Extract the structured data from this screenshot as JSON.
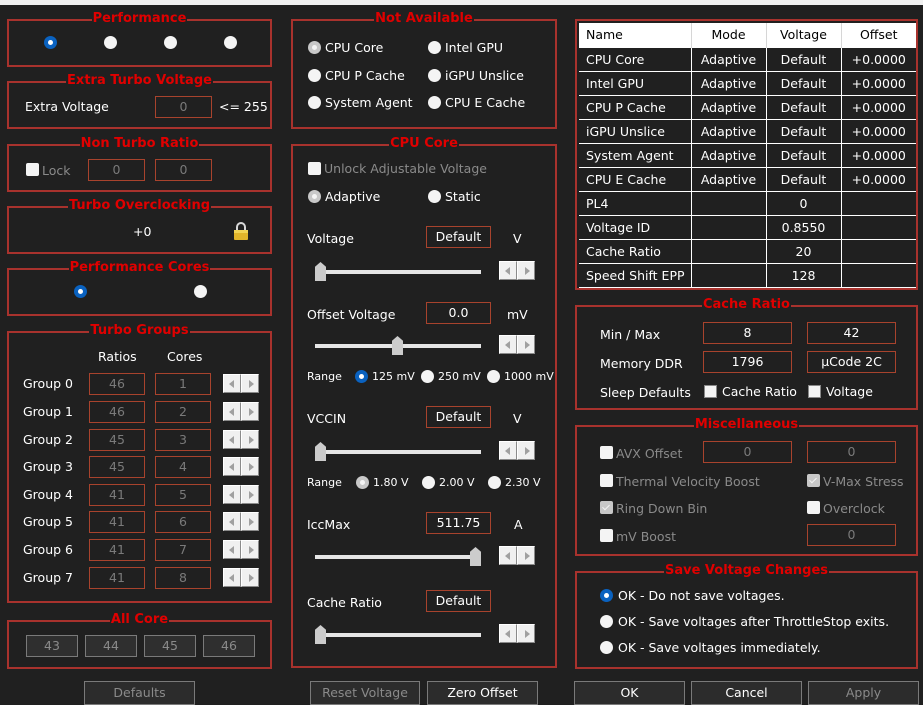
{
  "performance": {
    "title": "Performance",
    "options": [
      {
        "selected": true
      },
      {
        "selected": false
      },
      {
        "selected": false
      },
      {
        "selected": false
      }
    ]
  },
  "extra_turbo_voltage": {
    "title": "Extra Turbo Voltage",
    "label": "Extra Voltage",
    "value": "0",
    "limit": "<= 255"
  },
  "non_turbo_ratio": {
    "title": "Non Turbo Ratio",
    "lock_label": "Lock",
    "lock_checked": false,
    "value1": "0",
    "value2": "0"
  },
  "turbo_overclocking": {
    "title": "Turbo Overclocking",
    "value": "+0",
    "icon": "lock-icon"
  },
  "performance_cores": {
    "title": "Performance Cores",
    "options": [
      {
        "selected": true
      },
      {
        "selected": false
      }
    ]
  },
  "turbo_groups": {
    "title": "Turbo Groups",
    "col_ratios": "Ratios",
    "col_cores": "Cores",
    "groups": [
      {
        "label": "Group 0",
        "ratio": "46",
        "cores": "1"
      },
      {
        "label": "Group 1",
        "ratio": "46",
        "cores": "2"
      },
      {
        "label": "Group 2",
        "ratio": "45",
        "cores": "3"
      },
      {
        "label": "Group 3",
        "ratio": "45",
        "cores": "4"
      },
      {
        "label": "Group 4",
        "ratio": "41",
        "cores": "5"
      },
      {
        "label": "Group 5",
        "ratio": "41",
        "cores": "6"
      },
      {
        "label": "Group 6",
        "ratio": "41",
        "cores": "7"
      },
      {
        "label": "Group 7",
        "ratio": "41",
        "cores": "8"
      }
    ]
  },
  "all_core": {
    "title": "All Core",
    "values": [
      "43",
      "44",
      "45",
      "46"
    ]
  },
  "defaults_button": "Defaults",
  "not_available": {
    "title": "Not Available",
    "options": [
      {
        "label": "CPU Core",
        "selected": true
      },
      {
        "label": "Intel GPU",
        "selected": false
      },
      {
        "label": "CPU P Cache",
        "selected": false
      },
      {
        "label": "iGPU Unslice",
        "selected": false
      },
      {
        "label": "System Agent",
        "selected": false
      },
      {
        "label": "CPU E Cache",
        "selected": false
      }
    ]
  },
  "cpu_core": {
    "title": "CPU Core",
    "unlock_label": "Unlock Adjustable Voltage",
    "unlock_checked": false,
    "mode_adaptive": "Adaptive",
    "mode_static": "Static",
    "mode_selected": "Adaptive",
    "voltage": {
      "label": "Voltage",
      "value": "Default",
      "unit": "V",
      "slider": 0.0
    },
    "offset_voltage": {
      "label": "Offset Voltage",
      "value": "0.0",
      "unit": "mV",
      "slider": 0.5
    },
    "offset_range": {
      "label": "Range",
      "options": [
        "125 mV",
        "250 mV",
        "1000 mV"
      ],
      "selected": "125 mV"
    },
    "vccin": {
      "label": "VCCIN",
      "value": "Default",
      "unit": "V",
      "slider": 0.0
    },
    "vccin_range": {
      "label": "Range",
      "options": [
        "1.80 V",
        "2.00 V",
        "2.30 V"
      ],
      "selected": "1.80 V"
    },
    "iccmax": {
      "label": "IccMax",
      "value": "511.75",
      "unit": "A",
      "slider": 1.0
    },
    "cache_ratio": {
      "label": "Cache Ratio",
      "value": "Default",
      "slider": 0.0
    }
  },
  "reset_voltage_button": "Reset Voltage",
  "zero_offset_button": "Zero Offset",
  "table": {
    "headers": [
      "Name",
      "Mode",
      "Voltage",
      "Offset"
    ],
    "rows": [
      [
        "CPU Core",
        "Adaptive",
        "Default",
        "+0.0000"
      ],
      [
        "Intel GPU",
        "Adaptive",
        "Default",
        "+0.0000"
      ],
      [
        "CPU P Cache",
        "Adaptive",
        "Default",
        "+0.0000"
      ],
      [
        "iGPU Unslice",
        "Adaptive",
        "Default",
        "+0.0000"
      ],
      [
        "System Agent",
        "Adaptive",
        "Default",
        "+0.0000"
      ],
      [
        "CPU E Cache",
        "Adaptive",
        "Default",
        "+0.0000"
      ],
      [
        "PL4",
        "",
        "0",
        ""
      ],
      [
        "Voltage ID",
        "",
        "0.8550",
        ""
      ],
      [
        "Cache Ratio",
        "",
        "20",
        ""
      ],
      [
        "Speed Shift EPP",
        "",
        "128",
        ""
      ]
    ]
  },
  "cache_ratio_group": {
    "title": "Cache Ratio",
    "minmax_label": "Min / Max",
    "min": "8",
    "max": "42",
    "memory_label": "Memory DDR",
    "memory": "1796",
    "ucode": "µCode 2C",
    "sleep_label": "Sleep Defaults",
    "sleep_cache_label": "Cache Ratio",
    "sleep_cache_checked": false,
    "sleep_voltage_label": "Voltage",
    "sleep_voltage_checked": false
  },
  "misc": {
    "title": "Miscellaneous",
    "avx_label": "AVX Offset",
    "avx_checked": false,
    "avx_value1": "0",
    "avx_value2": "0",
    "tvb_label": "Thermal Velocity Boost",
    "tvb_checked": false,
    "vmax_label": "V-Max Stress",
    "vmax_checked": true,
    "ring_label": "Ring Down Bin",
    "ring_checked": true,
    "overclock_label": "Overclock",
    "overclock_checked": false,
    "mvboost_label": "mV Boost",
    "mvboost_checked": false,
    "mvboost_value": "0"
  },
  "save_voltage": {
    "title": "Save Voltage Changes",
    "options": [
      {
        "label": "OK - Do not save voltages.",
        "selected": true
      },
      {
        "label": "OK - Save voltages after ThrottleStop exits.",
        "selected": false
      },
      {
        "label": "OK - Save voltages immediately.",
        "selected": false
      }
    ]
  },
  "buttons": {
    "ok": "OK",
    "cancel": "Cancel",
    "apply": "Apply"
  },
  "colors": {
    "background": "#202020",
    "group_border": "#a8322d",
    "group_title": "#e00000",
    "radio_selected": "#0a62c0"
  }
}
